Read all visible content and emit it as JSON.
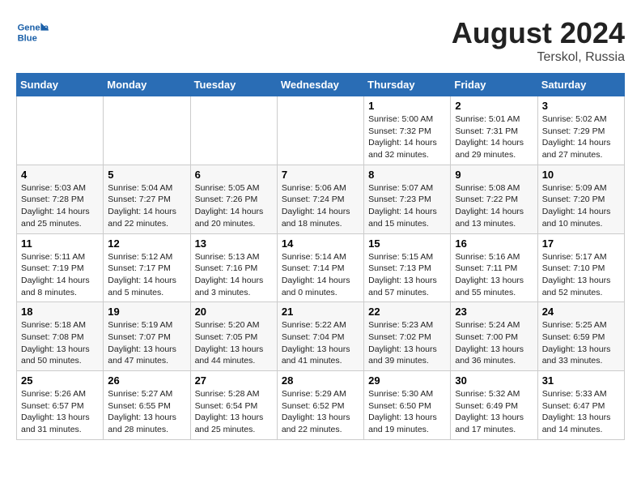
{
  "header": {
    "logo_text_general": "General",
    "logo_text_blue": "Blue",
    "month_year": "August 2024",
    "location": "Terskol, Russia"
  },
  "weekdays": [
    "Sunday",
    "Monday",
    "Tuesday",
    "Wednesday",
    "Thursday",
    "Friday",
    "Saturday"
  ],
  "weeks": [
    [
      {
        "day": "",
        "info": ""
      },
      {
        "day": "",
        "info": ""
      },
      {
        "day": "",
        "info": ""
      },
      {
        "day": "",
        "info": ""
      },
      {
        "day": "1",
        "info": "Sunrise: 5:00 AM\nSunset: 7:32 PM\nDaylight: 14 hours\nand 32 minutes."
      },
      {
        "day": "2",
        "info": "Sunrise: 5:01 AM\nSunset: 7:31 PM\nDaylight: 14 hours\nand 29 minutes."
      },
      {
        "day": "3",
        "info": "Sunrise: 5:02 AM\nSunset: 7:29 PM\nDaylight: 14 hours\nand 27 minutes."
      }
    ],
    [
      {
        "day": "4",
        "info": "Sunrise: 5:03 AM\nSunset: 7:28 PM\nDaylight: 14 hours\nand 25 minutes."
      },
      {
        "day": "5",
        "info": "Sunrise: 5:04 AM\nSunset: 7:27 PM\nDaylight: 14 hours\nand 22 minutes."
      },
      {
        "day": "6",
        "info": "Sunrise: 5:05 AM\nSunset: 7:26 PM\nDaylight: 14 hours\nand 20 minutes."
      },
      {
        "day": "7",
        "info": "Sunrise: 5:06 AM\nSunset: 7:24 PM\nDaylight: 14 hours\nand 18 minutes."
      },
      {
        "day": "8",
        "info": "Sunrise: 5:07 AM\nSunset: 7:23 PM\nDaylight: 14 hours\nand 15 minutes."
      },
      {
        "day": "9",
        "info": "Sunrise: 5:08 AM\nSunset: 7:22 PM\nDaylight: 14 hours\nand 13 minutes."
      },
      {
        "day": "10",
        "info": "Sunrise: 5:09 AM\nSunset: 7:20 PM\nDaylight: 14 hours\nand 10 minutes."
      }
    ],
    [
      {
        "day": "11",
        "info": "Sunrise: 5:11 AM\nSunset: 7:19 PM\nDaylight: 14 hours\nand 8 minutes."
      },
      {
        "day": "12",
        "info": "Sunrise: 5:12 AM\nSunset: 7:17 PM\nDaylight: 14 hours\nand 5 minutes."
      },
      {
        "day": "13",
        "info": "Sunrise: 5:13 AM\nSunset: 7:16 PM\nDaylight: 14 hours\nand 3 minutes."
      },
      {
        "day": "14",
        "info": "Sunrise: 5:14 AM\nSunset: 7:14 PM\nDaylight: 14 hours\nand 0 minutes."
      },
      {
        "day": "15",
        "info": "Sunrise: 5:15 AM\nSunset: 7:13 PM\nDaylight: 13 hours\nand 57 minutes."
      },
      {
        "day": "16",
        "info": "Sunrise: 5:16 AM\nSunset: 7:11 PM\nDaylight: 13 hours\nand 55 minutes."
      },
      {
        "day": "17",
        "info": "Sunrise: 5:17 AM\nSunset: 7:10 PM\nDaylight: 13 hours\nand 52 minutes."
      }
    ],
    [
      {
        "day": "18",
        "info": "Sunrise: 5:18 AM\nSunset: 7:08 PM\nDaylight: 13 hours\nand 50 minutes."
      },
      {
        "day": "19",
        "info": "Sunrise: 5:19 AM\nSunset: 7:07 PM\nDaylight: 13 hours\nand 47 minutes."
      },
      {
        "day": "20",
        "info": "Sunrise: 5:20 AM\nSunset: 7:05 PM\nDaylight: 13 hours\nand 44 minutes."
      },
      {
        "day": "21",
        "info": "Sunrise: 5:22 AM\nSunset: 7:04 PM\nDaylight: 13 hours\nand 41 minutes."
      },
      {
        "day": "22",
        "info": "Sunrise: 5:23 AM\nSunset: 7:02 PM\nDaylight: 13 hours\nand 39 minutes."
      },
      {
        "day": "23",
        "info": "Sunrise: 5:24 AM\nSunset: 7:00 PM\nDaylight: 13 hours\nand 36 minutes."
      },
      {
        "day": "24",
        "info": "Sunrise: 5:25 AM\nSunset: 6:59 PM\nDaylight: 13 hours\nand 33 minutes."
      }
    ],
    [
      {
        "day": "25",
        "info": "Sunrise: 5:26 AM\nSunset: 6:57 PM\nDaylight: 13 hours\nand 31 minutes."
      },
      {
        "day": "26",
        "info": "Sunrise: 5:27 AM\nSunset: 6:55 PM\nDaylight: 13 hours\nand 28 minutes."
      },
      {
        "day": "27",
        "info": "Sunrise: 5:28 AM\nSunset: 6:54 PM\nDaylight: 13 hours\nand 25 minutes."
      },
      {
        "day": "28",
        "info": "Sunrise: 5:29 AM\nSunset: 6:52 PM\nDaylight: 13 hours\nand 22 minutes."
      },
      {
        "day": "29",
        "info": "Sunrise: 5:30 AM\nSunset: 6:50 PM\nDaylight: 13 hours\nand 19 minutes."
      },
      {
        "day": "30",
        "info": "Sunrise: 5:32 AM\nSunset: 6:49 PM\nDaylight: 13 hours\nand 17 minutes."
      },
      {
        "day": "31",
        "info": "Sunrise: 5:33 AM\nSunset: 6:47 PM\nDaylight: 13 hours\nand 14 minutes."
      }
    ]
  ]
}
